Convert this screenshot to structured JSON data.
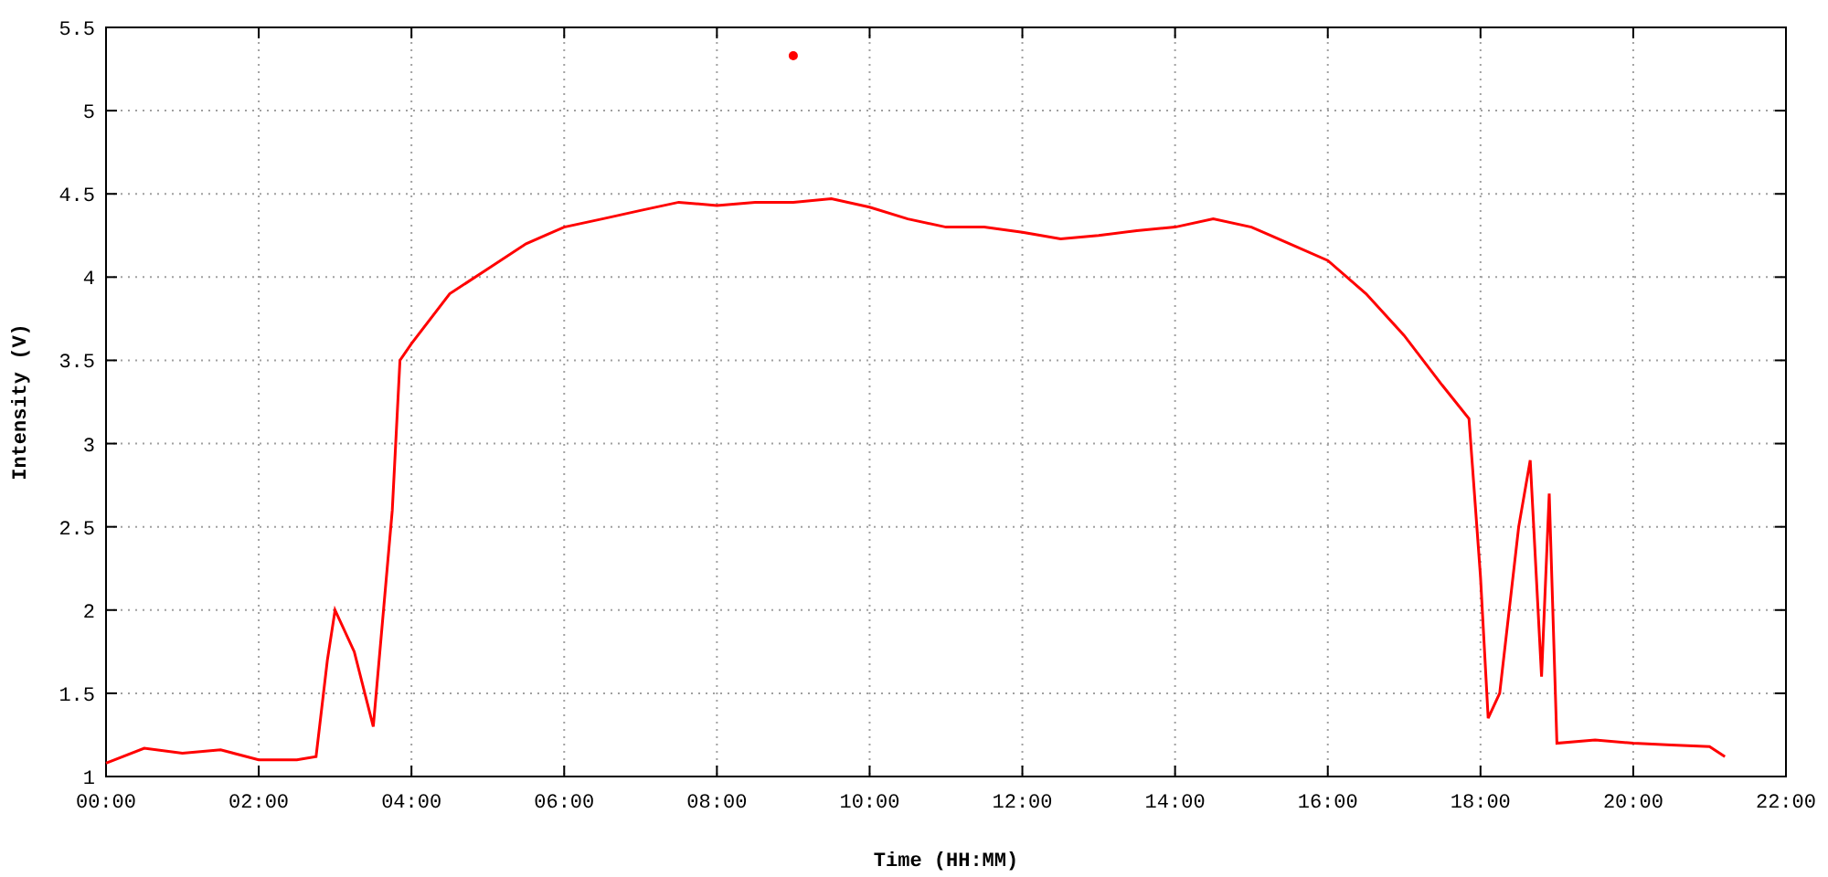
{
  "chart_data": {
    "type": "line",
    "xlabel": "Time (HH:MM)",
    "ylabel": "Intensity (V)",
    "x": [
      0,
      0.5,
      1,
      1.5,
      2,
      2.5,
      2.75,
      2.9,
      3,
      3.25,
      3.5,
      3.75,
      3.85,
      4,
      4.5,
      5,
      5.5,
      6,
      6.5,
      7,
      7.5,
      8,
      8.5,
      9,
      9.5,
      10,
      10.5,
      11,
      11.5,
      12,
      12.5,
      13,
      13.5,
      14,
      14.5,
      15,
      15.5,
      16,
      16.5,
      17,
      17.5,
      17.85,
      18,
      18.1,
      18.25,
      18.5,
      18.65,
      18.8,
      18.9,
      19,
      19.5,
      20,
      20.5,
      21,
      21.2
    ],
    "series": [
      {
        "color": "#ff0000",
        "values": [
          1.08,
          1.17,
          1.14,
          1.16,
          1.1,
          1.1,
          1.12,
          1.7,
          2.0,
          1.75,
          1.3,
          2.6,
          3.5,
          3.6,
          3.9,
          4.05,
          4.2,
          4.3,
          4.35,
          4.4,
          4.45,
          4.43,
          4.45,
          4.45,
          4.47,
          4.42,
          4.35,
          4.3,
          4.3,
          4.27,
          4.23,
          4.25,
          4.28,
          4.3,
          4.35,
          4.3,
          4.2,
          4.1,
          3.9,
          3.65,
          3.35,
          3.15,
          2.2,
          1.35,
          1.5,
          2.5,
          2.9,
          1.6,
          2.7,
          1.2,
          1.22,
          1.2,
          1.19,
          1.18,
          1.12
        ]
      },
      {
        "color": "#ff0000",
        "marker": "circle",
        "values": [
          null,
          null,
          null,
          null,
          null,
          null,
          null,
          null,
          null,
          null,
          null,
          null,
          null,
          null,
          null,
          null,
          null,
          null,
          null,
          null,
          null,
          null,
          null,
          5.33,
          null,
          null,
          null,
          null,
          null,
          null,
          null,
          null,
          null,
          null,
          null,
          null,
          null,
          null,
          null,
          null,
          null,
          null,
          null,
          null,
          null,
          null,
          null,
          null,
          null,
          null,
          null,
          null,
          null,
          null,
          null
        ]
      }
    ],
    "grid": true,
    "xlim": [
      0,
      22
    ],
    "ylim": [
      1,
      5.5
    ],
    "xticks": [
      {
        "value": 0,
        "label": "00:00"
      },
      {
        "value": 2,
        "label": "02:00"
      },
      {
        "value": 4,
        "label": "04:00"
      },
      {
        "value": 6,
        "label": "06:00"
      },
      {
        "value": 8,
        "label": "08:00"
      },
      {
        "value": 10,
        "label": "10:00"
      },
      {
        "value": 12,
        "label": "12:00"
      },
      {
        "value": 14,
        "label": "14:00"
      },
      {
        "value": 16,
        "label": "16:00"
      },
      {
        "value": 18,
        "label": "18:00"
      },
      {
        "value": 20,
        "label": "20:00"
      },
      {
        "value": 22,
        "label": "22:00"
      }
    ],
    "yticks": [
      1,
      1.5,
      2,
      2.5,
      3,
      3.5,
      4,
      4.5,
      5,
      5.5
    ]
  }
}
